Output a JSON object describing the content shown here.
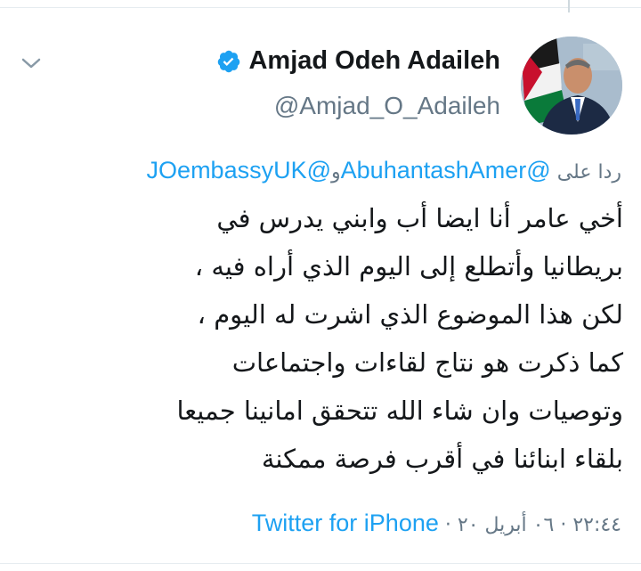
{
  "author": {
    "name": "Amjad Odeh Adaileh",
    "handle": "@Amjad_O_Adaileh"
  },
  "reply": {
    "prefix": "ردا على",
    "mention1": "@AbuhantashAmer",
    "conjunction": "و",
    "mention2": "@JOembassyUK"
  },
  "tweet": {
    "lines": [
      "أخي عامر أنا ايضا أب وابني يدرس في",
      "بريطانيا وأتطلع إلى اليوم الذي أراه فيه ،",
      "لكن هذا الموضوع الذي اشرت له اليوم ،",
      "كما ذكرت هو نتاج لقاءات واجتماعات",
      "وتوصيات وان شاء الله تتحقق امانينا جميعا",
      "بلقاء ابنائنا في أقرب فرصة ممكنة"
    ]
  },
  "meta": {
    "time": "٢٢:٤٤",
    "separator1": "·",
    "date": "٠٦ أبريل ٢٠",
    "separator2": "·",
    "source": "Twitter for iPhone"
  },
  "icons": {
    "menu": "chevron-down-icon",
    "verified": "verified-badge-icon"
  },
  "colors": {
    "link": "#1da1f2",
    "secondary": "#657786",
    "text": "#14171a"
  }
}
